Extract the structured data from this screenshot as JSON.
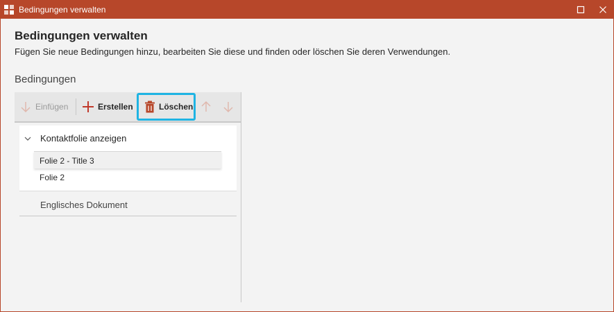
{
  "window": {
    "title": "Bedingungen verwalten",
    "accent": "#b7472a"
  },
  "header": {
    "heading": "Bedingungen verwalten",
    "subtitle": "Fügen Sie neue Bedingungen hinzu, bearbeiten Sie diese und finden oder löschen Sie deren Verwendungen."
  },
  "section": {
    "label": "Bedingungen"
  },
  "toolbar": {
    "insert_label": "Einfügen",
    "create_label": "Erstellen",
    "delete_label": "Löschen",
    "highlight_color": "#1fb4e3",
    "icons": [
      "arrow-down-icon",
      "plus-icon",
      "trash-icon",
      "arrow-up-icon",
      "arrow-down-icon"
    ]
  },
  "tree": {
    "groups": [
      {
        "label": "Kontaktfolie anzeigen",
        "expanded": true,
        "children": [
          {
            "label": "Folie 2 - Title 3",
            "selected": true
          },
          {
            "label": "Folie 2",
            "selected": false
          }
        ]
      },
      {
        "label": "Englisches Dokument",
        "expanded": false
      }
    ]
  }
}
